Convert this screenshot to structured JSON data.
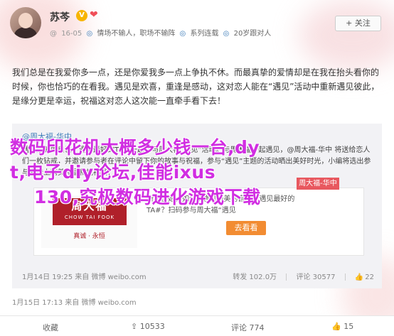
{
  "header": {
    "author": "苏芩",
    "vip_badge": "V",
    "meta": [
      "@",
      "16-05",
      "情场不输人，职场不输阵",
      "#",
      "系列连载",
      "20岁跟对人"
    ],
    "follow_label": "+ 关注",
    "heart_icon": "heart-icon"
  },
  "post": {
    "text": "我们总是在我爱你多一点，还是你爱我多一点上争执不休。而最真挚的爱情却是在我在抬头看你的时候，你也恰巧的在看我。遇见是欢喜，重逢是感动，这对恋人能在“遇见”活动中重新遇见彼此，是缘分更是幸运，祝福这对恋人这次能一直牵手看下去！"
  },
  "repost": {
    "author": "@周大福-华中",
    "text": "遇见最美的自己，遇见最好的TA，一起参与周大福“遇见”活动。与周大福一起遇见，@周大福-华中 将送给恋人们一枚钻戒，并邀请参与者在评论中留下你的故事与祝福，参与“遇见”主题的活动晒出美好时光，小编将选出参与者送上精美礼品和祝福哦！",
    "ad": {
      "badge": "周大福-华中",
      "logo_line1": "周大福",
      "logo_line2": "CHOW TAI FOOK",
      "logo_sub": "真诚 · 永恒",
      "text": "新年伊始，如何#遇见最美的自己，遇见最好的TA#？扫码参与周大福“遇见",
      "button": "去看看"
    },
    "time": "1月14日 19:25 来自 微博 weibo.com",
    "stats": {
      "forward": "转发 102.0万",
      "comment": "评论 30577",
      "like_count": "22"
    }
  },
  "post_time": "1月15日 17:13 来自 微博 weibo.com",
  "actions": {
    "favorite": "收藏",
    "forward": "10533",
    "comment": "评论 774",
    "like": "15"
  },
  "overlay": {
    "line1": "数码印花机大概多少钱一台,dy",
    "line2": "t,电子diy论坛,佳能ixus",
    "line3": "130,究极数码进化游戏下载"
  }
}
